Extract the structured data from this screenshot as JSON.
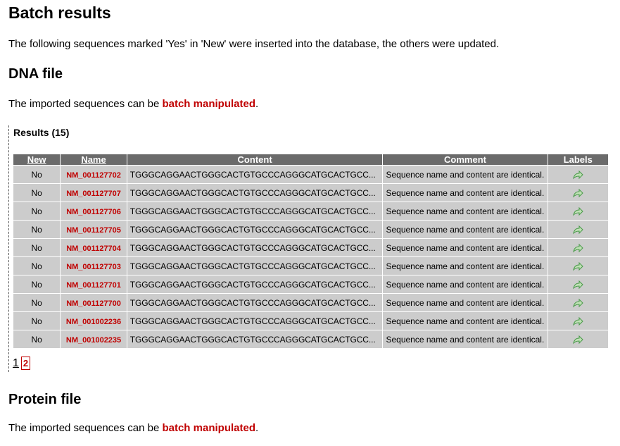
{
  "page_title": "Batch results",
  "intro": "The following sequences marked 'Yes' in 'New' were inserted into the database, the others were updated.",
  "dna": {
    "heading": "DNA file",
    "text_before": "The imported sequences can be ",
    "link": "batch manipulated",
    "text_after": "."
  },
  "results": {
    "title": "Results (15)",
    "columns": {
      "new": "New",
      "name": "Name",
      "content": "Content",
      "comment": "Comment",
      "labels": "Labels"
    },
    "rows": [
      {
        "new": "No",
        "name": "NM_001127702",
        "content": "TGGGCAGGAACTGGGCACTGTGCCCAGGGCATGCACTGCC...",
        "comment": "Sequence name and content are identical."
      },
      {
        "new": "No",
        "name": "NM_001127707",
        "content": "TGGGCAGGAACTGGGCACTGTGCCCAGGGCATGCACTGCC...",
        "comment": "Sequence name and content are identical."
      },
      {
        "new": "No",
        "name": "NM_001127706",
        "content": "TGGGCAGGAACTGGGCACTGTGCCCAGGGCATGCACTGCC...",
        "comment": "Sequence name and content are identical."
      },
      {
        "new": "No",
        "name": "NM_001127705",
        "content": "TGGGCAGGAACTGGGCACTGTGCCCAGGGCATGCACTGCC...",
        "comment": "Sequence name and content are identical."
      },
      {
        "new": "No",
        "name": "NM_001127704",
        "content": "TGGGCAGGAACTGGGCACTGTGCCCAGGGCATGCACTGCC...",
        "comment": "Sequence name and content are identical."
      },
      {
        "new": "No",
        "name": "NM_001127703",
        "content": "TGGGCAGGAACTGGGCACTGTGCCCAGGGCATGCACTGCC...",
        "comment": "Sequence name and content are identical."
      },
      {
        "new": "No",
        "name": "NM_001127701",
        "content": "TGGGCAGGAACTGGGCACTGTGCCCAGGGCATGCACTGCC...",
        "comment": "Sequence name and content are identical."
      },
      {
        "new": "No",
        "name": "NM_001127700",
        "content": "TGGGCAGGAACTGGGCACTGTGCCCAGGGCATGCACTGCC...",
        "comment": "Sequence name and content are identical."
      },
      {
        "new": "No",
        "name": "NM_001002236",
        "content": "TGGGCAGGAACTGGGCACTGTGCCCAGGGCATGCACTGCC...",
        "comment": "Sequence name and content are identical."
      },
      {
        "new": "No",
        "name": "NM_001002235",
        "content": "TGGGCAGGAACTGGGCACTGTGCCCAGGGCATGCACTGCC...",
        "comment": "Sequence name and content are identical."
      }
    ],
    "label_icon": "share-arrow-icon",
    "pagination": {
      "page1": "1",
      "page2": "2",
      "current": "2"
    }
  },
  "protein": {
    "heading": "Protein file",
    "text_before": "The imported sequences can be ",
    "link": "batch manipulated",
    "text_after": "."
  },
  "colors": {
    "link_red": "#c00000",
    "header_gray": "#6b6b6b",
    "row_gray": "#cccccc",
    "icon_green": "#4a9a4a"
  }
}
